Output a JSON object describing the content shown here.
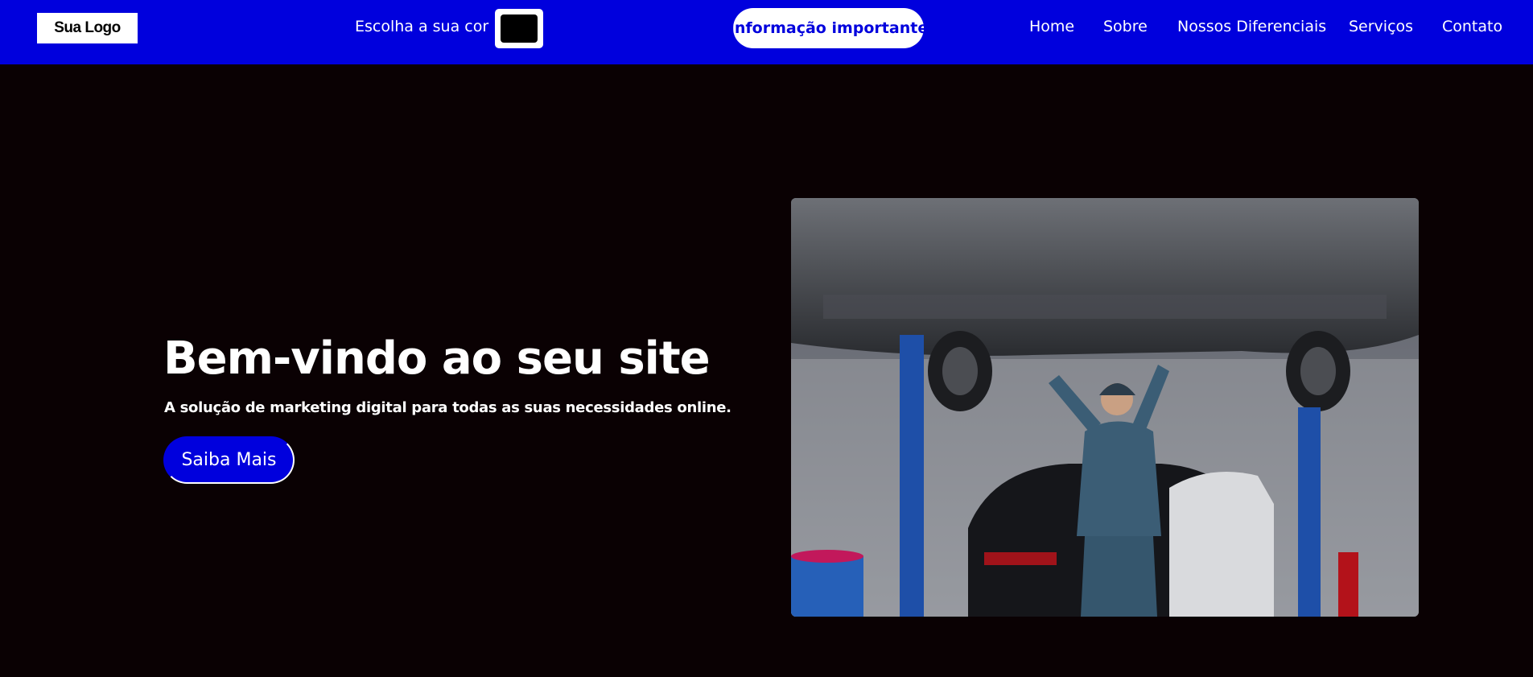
{
  "header": {
    "logo_text": "Sua Logo",
    "color_picker_label": "Escolha a sua cor",
    "color_picker_value": "#000000",
    "info_button_label": "Informação importante",
    "nav": [
      {
        "label": "Home"
      },
      {
        "label": "Sobre"
      },
      {
        "label": "Nossos Diferenciais"
      },
      {
        "label": "Serviços"
      },
      {
        "label": "Contato"
      }
    ]
  },
  "hero": {
    "title": "Bem-vindo ao seu site",
    "subtitle": "A solução de marketing digital para todas as suas necessidades online.",
    "cta_label": "Saiba Mais",
    "image_subject": "mechanic-under-car-photo"
  },
  "colors": {
    "accent": "#0000dd",
    "background": "#0a0103",
    "text": "#ffffff"
  }
}
